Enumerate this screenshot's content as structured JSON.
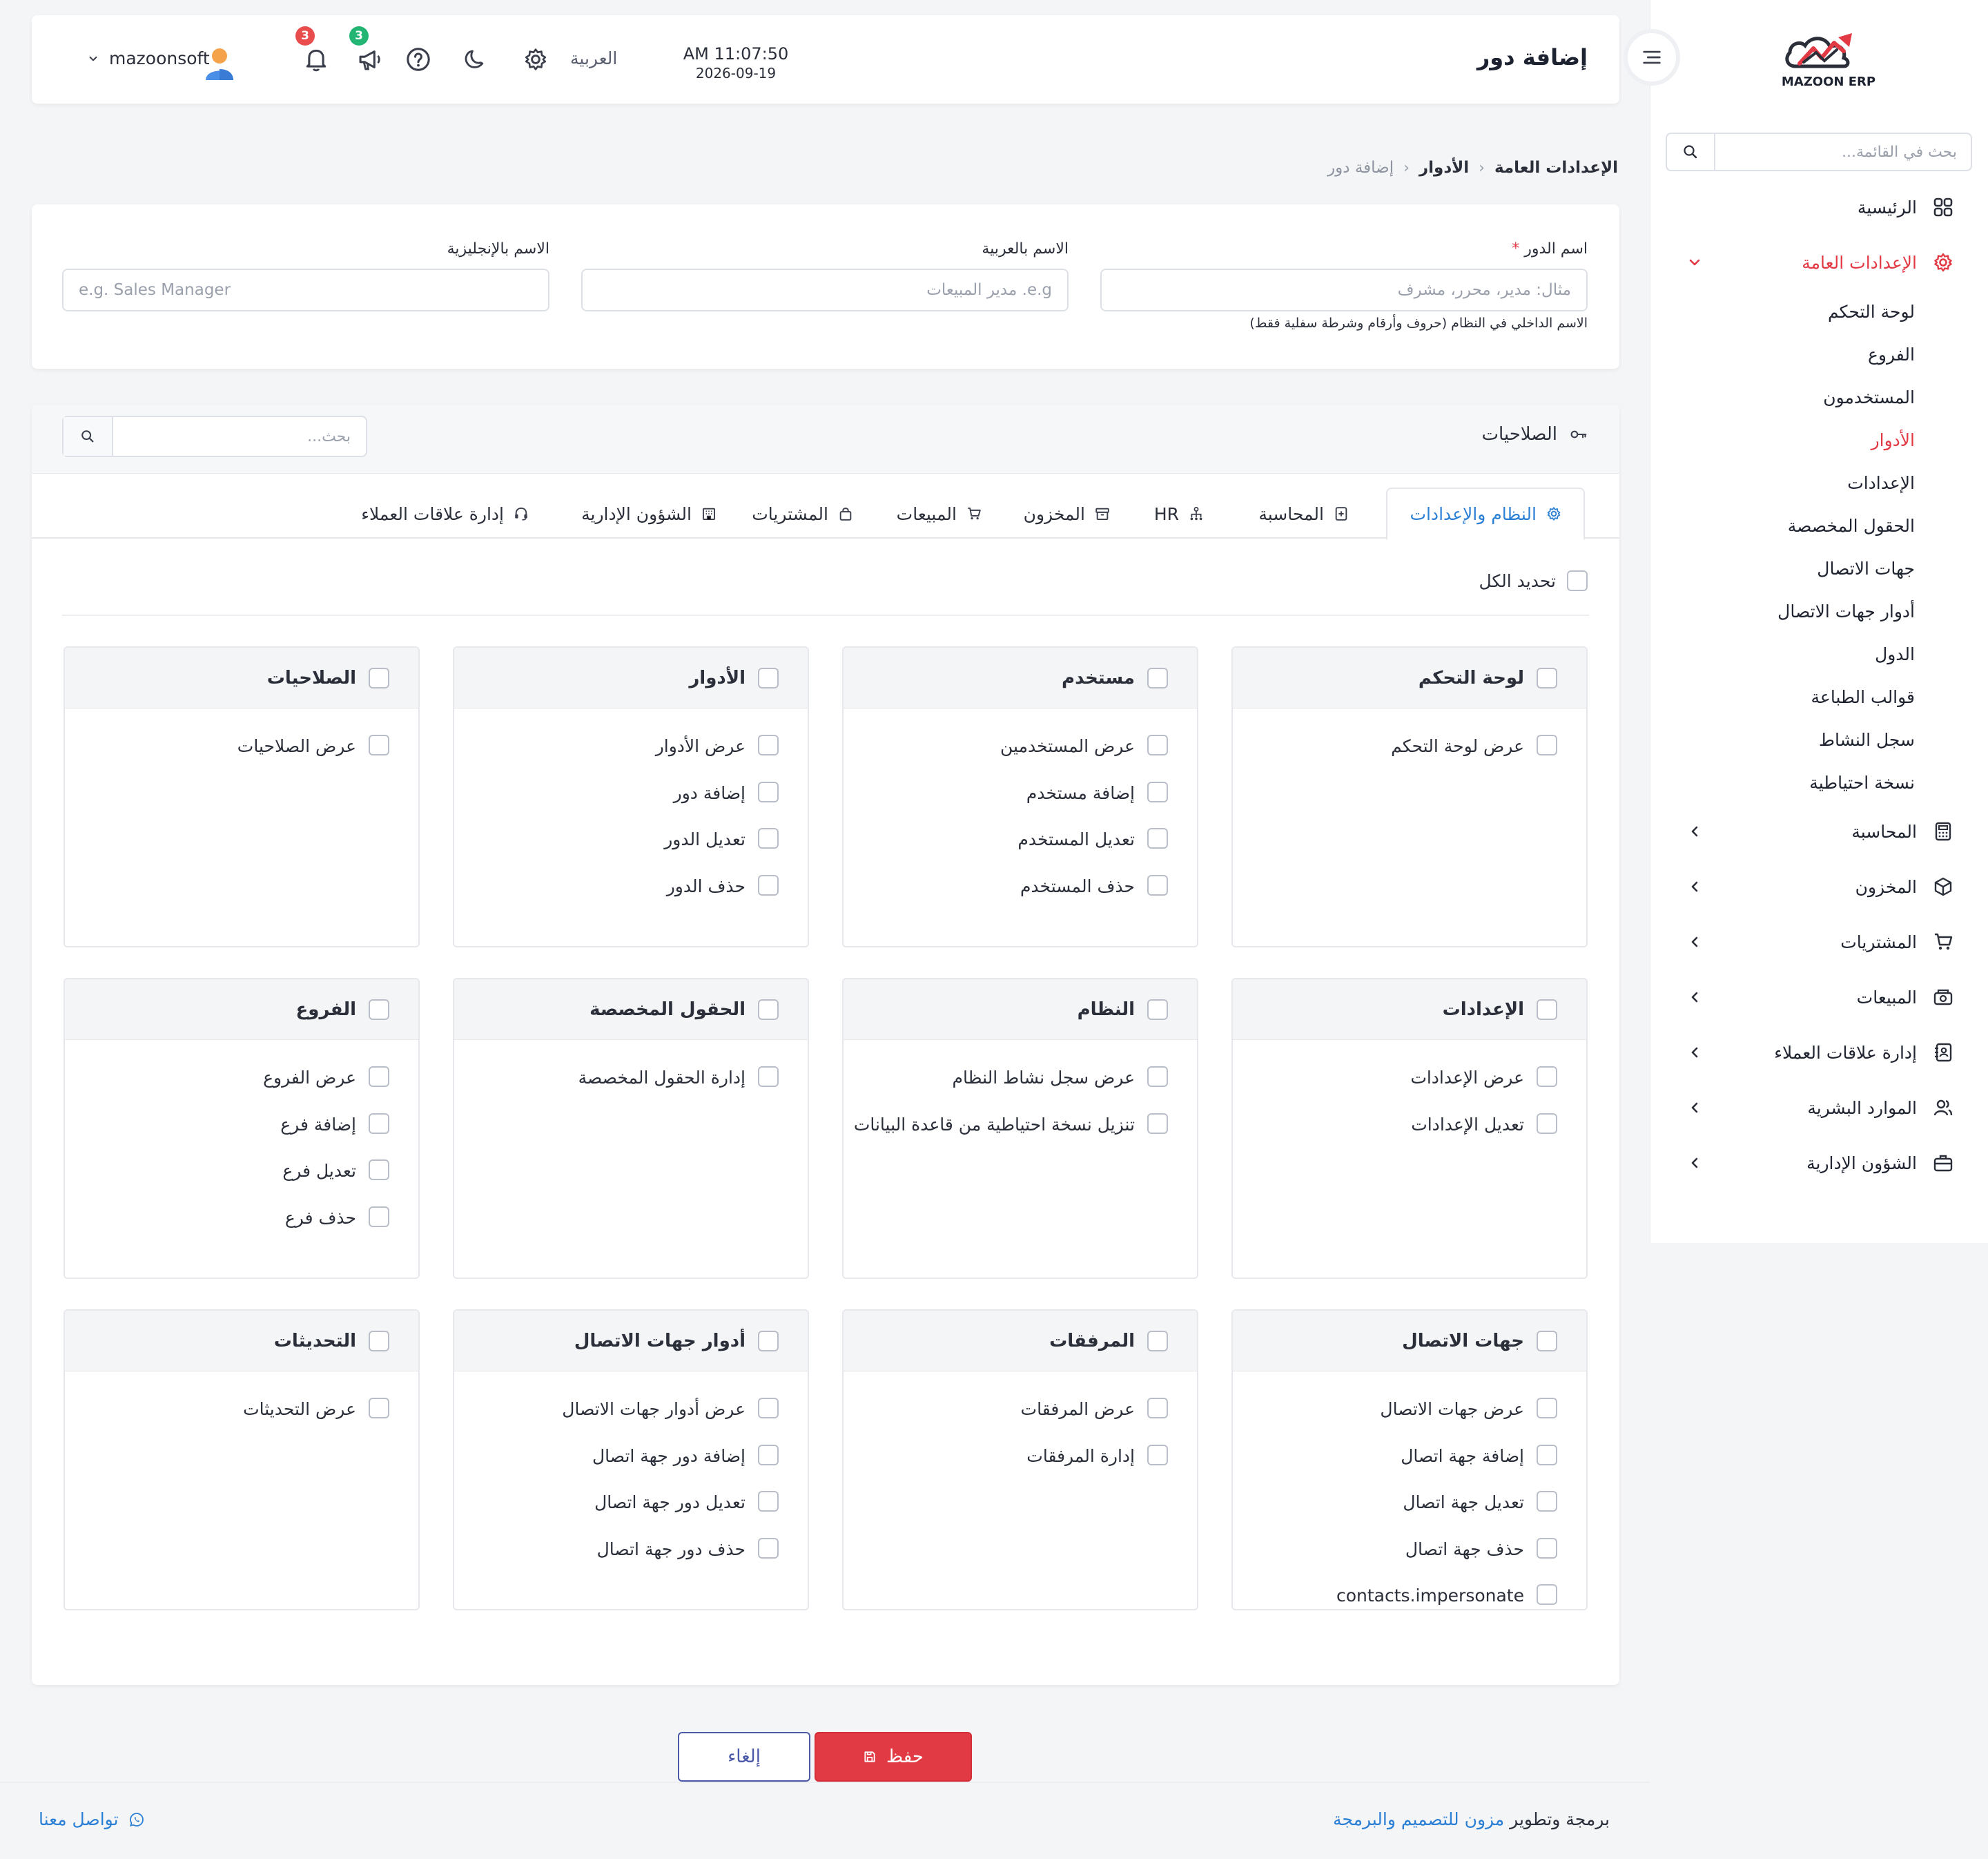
{
  "brand": {
    "logo_text": "MAZOON ERP",
    "logo_subtext": "ERP",
    "accent": "#e23a45",
    "link": "#2b7fd4"
  },
  "sidebar": {
    "search_placeholder": "بحث في القائمة...",
    "home": "الرئيسية",
    "general_settings": "الإعدادات العامة",
    "sub_items": [
      "لوحة التحكم",
      "الفروع",
      "المستخدمون",
      "الأدوار",
      "الإعدادات",
      "الحقول المخصصة",
      "جهات الاتصال",
      "أدوار جهات الاتصال",
      "الدول",
      "قوالب الطباعة",
      "سجل النشاط",
      "نسخة احتياطية"
    ],
    "active_sub": "الأدوار",
    "modules": [
      "المحاسبة",
      "المخزون",
      "المشتريات",
      "المبيعات",
      "إدارة علاقات العملاء",
      "الموارد البشرية",
      "الشؤون الإدارية"
    ]
  },
  "header": {
    "title": "إضافة دور",
    "time": "AM 11:07:50",
    "date": "2026-09-19",
    "language": "العربية",
    "announcements_count": "3",
    "notifications_count": "3",
    "username": "mazoonsoft"
  },
  "breadcrumb": {
    "root": "الإعدادات العامة",
    "parent": "الأدوار",
    "current": "إضافة دور"
  },
  "form": {
    "role_name": {
      "label": "اسم الدور",
      "required_mark": "*",
      "placeholder": "مثال: مدير، محرر، مشرف",
      "hint": "الاسم الداخلي في النظام (حروف وأرقام وشرطة سفلية فقط)"
    },
    "name_ar": {
      "label": "الاسم بالعربية",
      "placeholder": "e.g. مدير المبيعات"
    },
    "name_en": {
      "label": "الاسم بالإنجليزية",
      "placeholder": "e.g. Sales Manager"
    }
  },
  "permissions": {
    "title": "الصلاحيات",
    "search_placeholder": "بحث...",
    "tabs": [
      "النظام والإعدادات",
      "المحاسبة",
      "HR",
      "المخزون",
      "المبيعات",
      "المشتريات",
      "الشؤون الإدارية",
      "إدارة علاقات العملاء"
    ],
    "active_tab": "النظام والإعدادات",
    "select_all": "تحديد الكل",
    "groups": [
      {
        "title": "لوحة التحكم",
        "items": [
          "عرض لوحة التحكم"
        ]
      },
      {
        "title": "مستخدم",
        "items": [
          "عرض المستخدمين",
          "إضافة مستخدم",
          "تعديل المستخدم",
          "حذف المستخدم"
        ]
      },
      {
        "title": "الأدوار",
        "items": [
          "عرض الأدوار",
          "إضافة دور",
          "تعديل الدور",
          "حذف الدور"
        ]
      },
      {
        "title": "الصلاحيات",
        "items": [
          "عرض الصلاحيات"
        ]
      },
      {
        "title": "الإعدادات",
        "items": [
          "عرض الإعدادات",
          "تعديل الإعدادات"
        ]
      },
      {
        "title": "النظام",
        "items": [
          "عرض سجل نشاط النظام",
          "تنزيل نسخة احتياطية من قاعدة البيانات"
        ]
      },
      {
        "title": "الحقول المخصصة",
        "items": [
          "إدارة الحقول المخصصة"
        ]
      },
      {
        "title": "الفروع",
        "items": [
          "عرض الفروع",
          "إضافة فرع",
          "تعديل فرع",
          "حذف فرع"
        ]
      },
      {
        "title": "جهات الاتصال",
        "items": [
          "عرض جهات الاتصال",
          "إضافة جهة اتصال",
          "تعديل جهة اتصال",
          "حذف جهة اتصال",
          "contacts.impersonate"
        ]
      },
      {
        "title": "المرفقات",
        "items": [
          "عرض المرفقات",
          "إدارة المرفقات"
        ]
      },
      {
        "title": "أدوار جهات الاتصال",
        "items": [
          "عرض أدوار جهات الاتصال",
          "إضافة دور جهة اتصال",
          "تعديل دور جهة اتصال",
          "حذف دور جهة اتصال"
        ]
      },
      {
        "title": "التحديثات",
        "items": [
          "عرض التحديثات"
        ]
      }
    ]
  },
  "actions": {
    "save": "حفظ",
    "cancel": "إلغاء"
  },
  "footer": {
    "credit_prefix": "برمجة وتطوير",
    "credit_link": "مزون للتصميم والبرمجة",
    "contact": "تواصل معنا"
  }
}
